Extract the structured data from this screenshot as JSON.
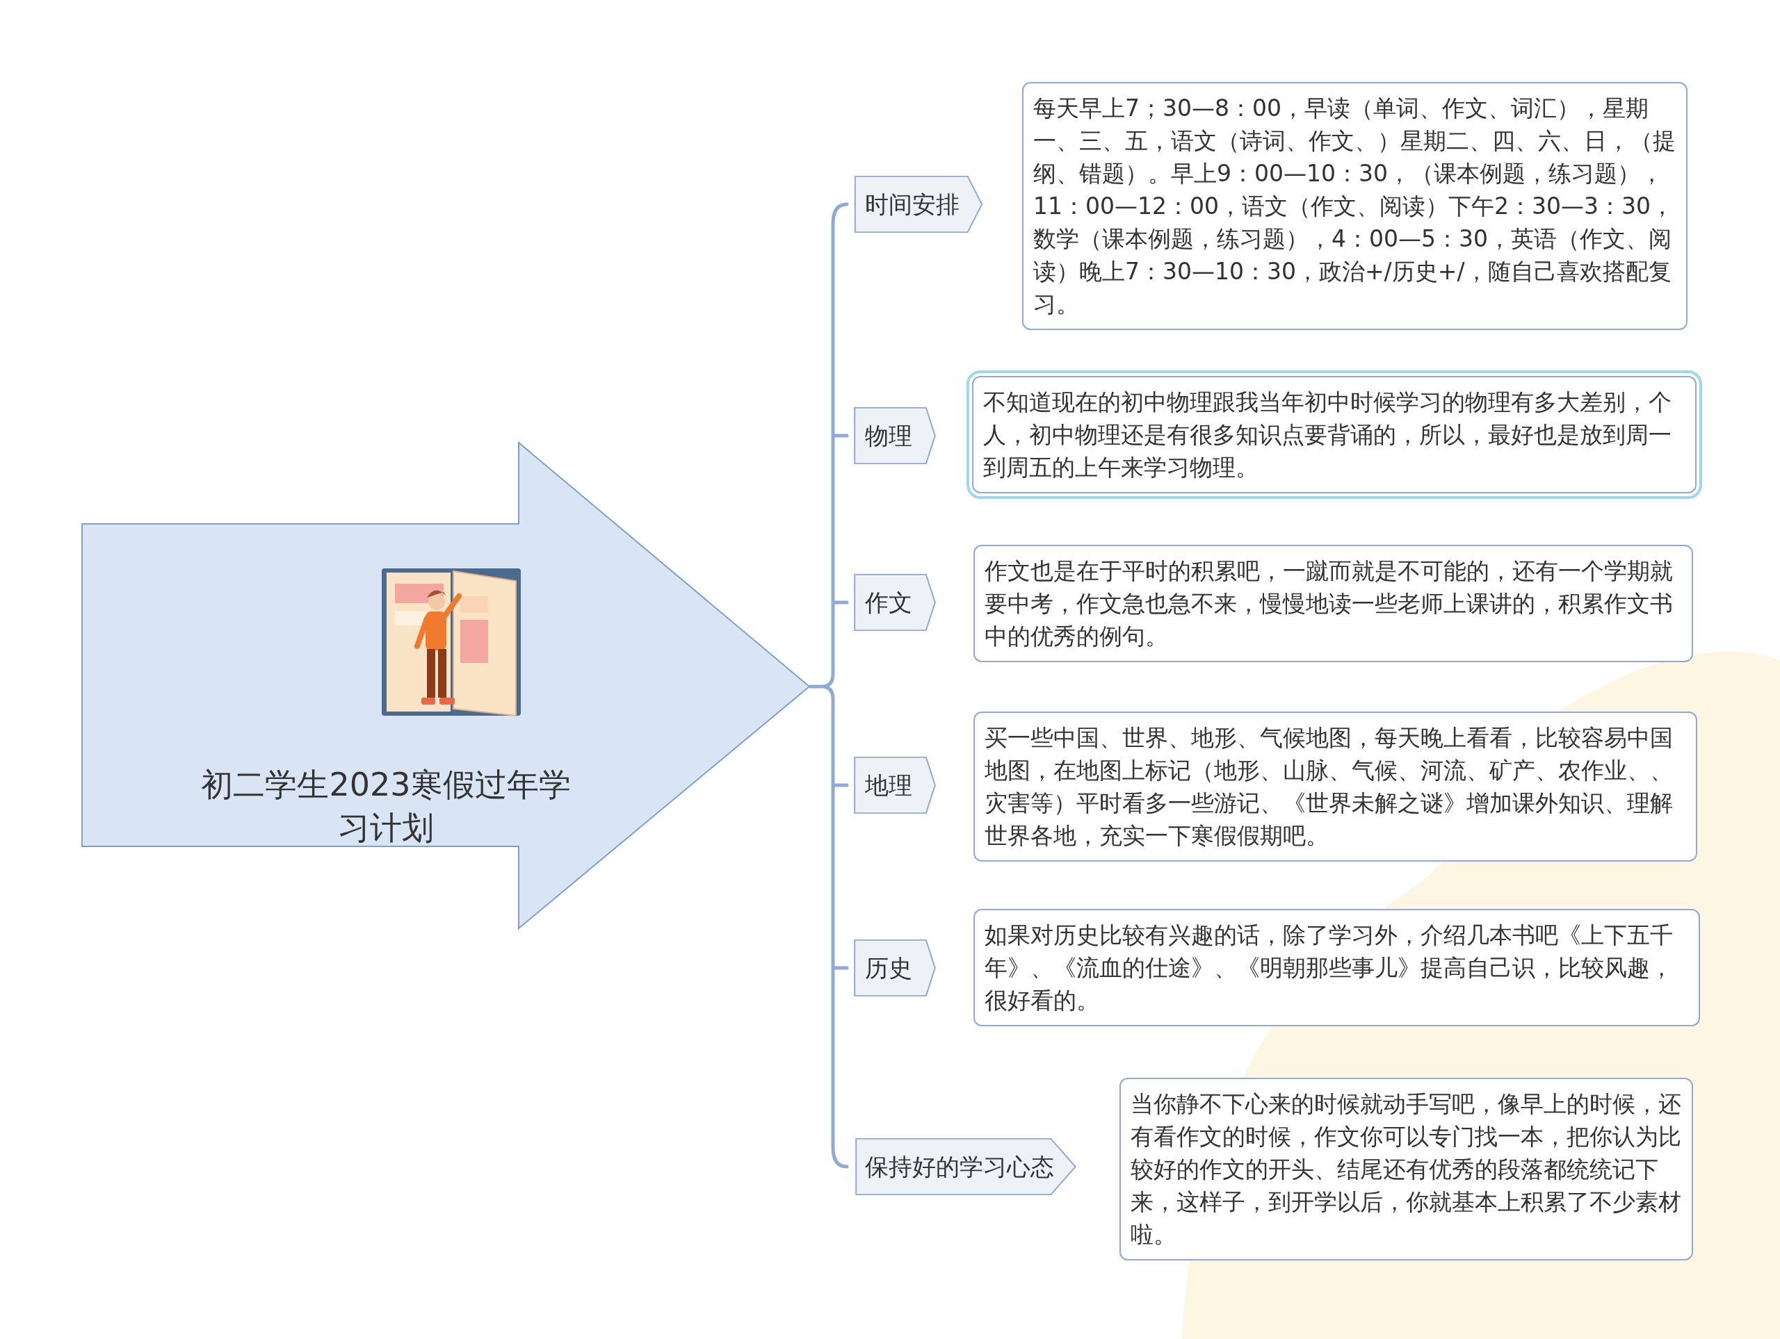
{
  "central_topic": {
    "title": "初二学生2023寒假过年学习计划"
  },
  "branches": [
    {
      "label": "时间安排",
      "note": "每天早上7；30—8：00，早读（单词、作文、词汇），星期一、三、五，语文（诗词、作文、）星期二、四、六、日，（提纲、错题）。早上9：00—10：30，（课本例题，练习题），11：00—12：00，语文（作文、阅读）下午2：30—3：30，数学（课本例题，练习题），4：00—5：30，英语（作文、阅读）晚上7：30—10：30，政治+/历史+/，随自己喜欢搭配复习。",
      "selected": false
    },
    {
      "label": "物理",
      "note": "不知道现在的初中物理跟我当年初中时候学习的物理有多大差别，个人，初中物理还是有很多知识点要背诵的，所以，最好也是放到周一到周五的上午来学习物理。",
      "selected": true
    },
    {
      "label": "作文",
      "note": "作文也是在于平时的积累吧，一蹴而就是不可能的，还有一个学期就要中考，作文急也急不来，慢慢地读一些老师上课讲的，积累作文书中的优秀的例句。",
      "selected": false
    },
    {
      "label": "地理",
      "note": "买一些中国、世界、地形、气候地图，每天晚上看看，比较容易中国地图，在地图上标记（地形、山脉、气候、河流、矿产、农作业、、灾害等）平时看多一些游记、《世界未解之谜》增加课外知识、理解世界各地，充实一下寒假假期吧。",
      "selected": false
    },
    {
      "label": "历史",
      "note": "如果对历史比较有兴趣的话，除了学习外，介绍几本书吧《上下五千年》、《流血的仕途》、《明朝那些事儿》提高自己识，比较风趣，很好看的。",
      "selected": false
    },
    {
      "label": "保持好的学习心态",
      "note": "当你静不下心来的时候就动手写吧，像早上的时候，还有看作文的时候，作文你可以专门找一本，把你认为比较好的作文的开头、结尾还有优秀的段落都统统记下来，这样子，到开学以后，你就基本上积累了不少素材啦。",
      "selected": false
    }
  ]
}
